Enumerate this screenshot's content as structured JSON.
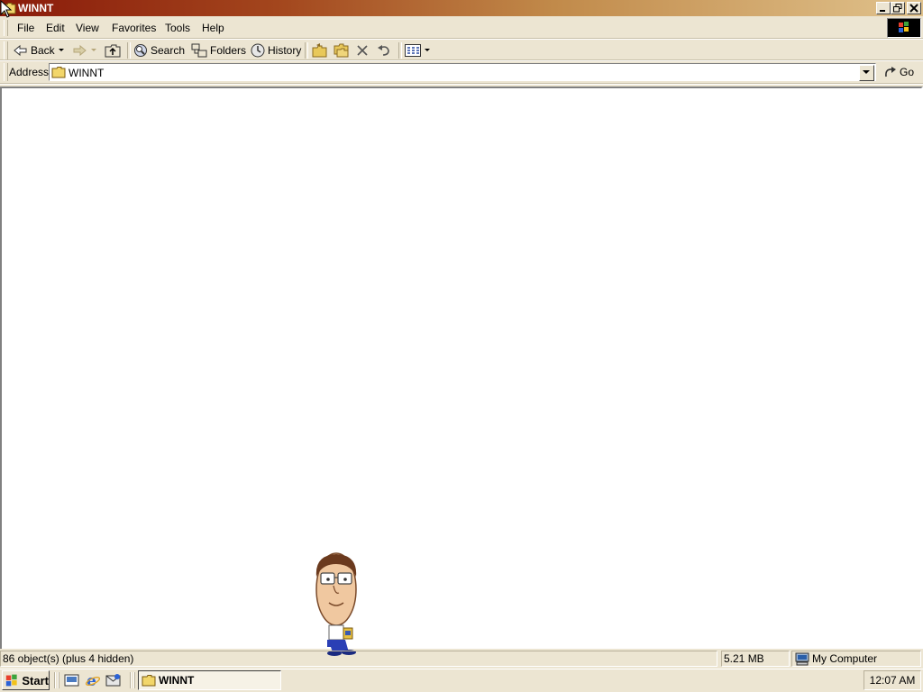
{
  "window": {
    "title": "WINNT"
  },
  "menu": {
    "items": [
      "File",
      "Edit",
      "View",
      "Favorites",
      "Tools",
      "Help"
    ]
  },
  "toolbar": {
    "back_label": "Back",
    "search_label": "Search",
    "folders_label": "Folders",
    "history_label": "History"
  },
  "address": {
    "label": "Address",
    "value": "WINNT",
    "go_label": "Go"
  },
  "status": {
    "objects": "86 object(s) (plus 4 hidden)",
    "size": "5.21 MB",
    "zone": "My Computer"
  },
  "taskbar": {
    "start_label": "Start",
    "task_label": "WINNT",
    "clock": "12:07 AM"
  },
  "colors": {
    "titlebar_start": "#8a1a0a",
    "titlebar_end": "#e0c28c",
    "chrome": "#ece5d2"
  },
  "icons": [
    "folder-icon",
    "back-arrow-icon",
    "forward-arrow-icon",
    "up-folder-icon",
    "search-icon",
    "folders-icon",
    "history-icon",
    "move-to-icon",
    "copy-to-icon",
    "delete-icon",
    "undo-icon",
    "views-icon",
    "go-icon",
    "computer-icon",
    "windows-logo-icon"
  ]
}
